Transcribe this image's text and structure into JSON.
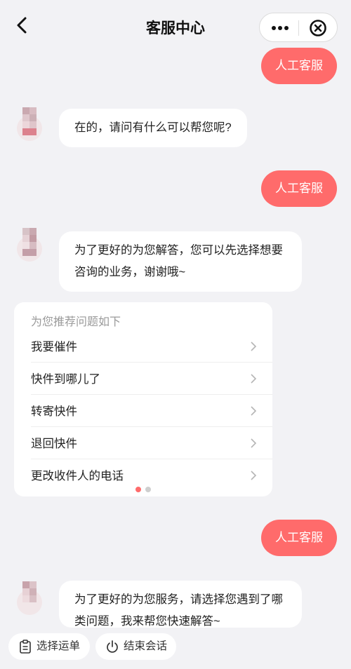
{
  "header": {
    "title": "客服中心",
    "back_icon": "chevron-left-icon",
    "more_icon": "more-dots-icon",
    "close_icon": "close-circle-icon"
  },
  "messages": {
    "out_1": "人工客服",
    "in_1": "在的，请问有什么可以帮您呢?",
    "out_2": "人工客服",
    "in_2_line1": "为了更好的为您解答，您可以先选择想要",
    "in_2_line2": "咨询的业务，谢谢哦~",
    "out_3": "人工客服",
    "in_3_line1": "为了更好的为您服务，请选择您遇到了哪",
    "in_3_line2": "类问题，我来帮您快速解答~"
  },
  "recommend": {
    "title": "为您推荐问题如下",
    "items": [
      {
        "label": "我要催件"
      },
      {
        "label": "快件到哪儿了"
      },
      {
        "label": "转寄快件"
      },
      {
        "label": "退回快件"
      },
      {
        "label": "更改收件人的电话"
      }
    ],
    "page_indicator": {
      "current": 1,
      "total": 2
    }
  },
  "bottom": {
    "select_waybill": "选择运单",
    "end_session": "结束会话"
  },
  "colors": {
    "accent": "#ff6b6b",
    "background": "#f2f2f5",
    "bubble": "#ffffff"
  }
}
